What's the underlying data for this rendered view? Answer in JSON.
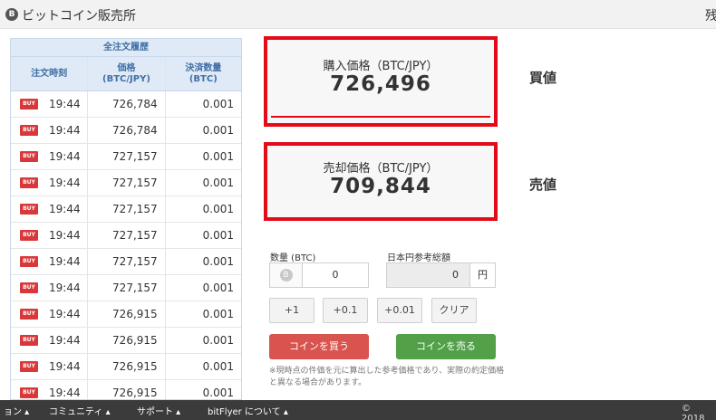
{
  "header": {
    "logo_glyph": "B",
    "title": "ビットコイン販売所",
    "right_cut_text": "残"
  },
  "history": {
    "title": "全注文履歴",
    "columns": [
      "注文時刻",
      "価格\n(BTC/JPY)",
      "決済数量\n(BTC)"
    ],
    "rows": [
      {
        "badge": "BUY",
        "time": "19:44",
        "price": "726,784",
        "qty": "0.001"
      },
      {
        "badge": "BUY",
        "time": "19:44",
        "price": "726,784",
        "qty": "0.001"
      },
      {
        "badge": "BUY",
        "time": "19:44",
        "price": "727,157",
        "qty": "0.001"
      },
      {
        "badge": "BUY",
        "time": "19:44",
        "price": "727,157",
        "qty": "0.001"
      },
      {
        "badge": "BUY",
        "time": "19:44",
        "price": "727,157",
        "qty": "0.001"
      },
      {
        "badge": "BUY",
        "time": "19:44",
        "price": "727,157",
        "qty": "0.001"
      },
      {
        "badge": "BUY",
        "time": "19:44",
        "price": "727,157",
        "qty": "0.001"
      },
      {
        "badge": "BUY",
        "time": "19:44",
        "price": "727,157",
        "qty": "0.001"
      },
      {
        "badge": "BUY",
        "time": "19:44",
        "price": "726,915",
        "qty": "0.001"
      },
      {
        "badge": "BUY",
        "time": "19:44",
        "price": "726,915",
        "qty": "0.001"
      },
      {
        "badge": "BUY",
        "time": "19:44",
        "price": "726,915",
        "qty": "0.001"
      },
      {
        "badge": "BUY",
        "time": "19:44",
        "price": "726,915",
        "qty": "0.001"
      }
    ]
  },
  "buy_price": {
    "label": "購入価格（BTC/JPY）",
    "value": "726,496",
    "side_label": "買値"
  },
  "sell_price": {
    "label": "売却価格（BTC/JPY）",
    "value": "709,844",
    "side_label": "売値"
  },
  "form": {
    "qty_label": "数量 (BTC)",
    "qty_value": "0",
    "jpy_label": "日本円参考総額",
    "jpy_value": "0",
    "jpy_unit": "円",
    "steps": [
      "+1",
      "+0.1",
      "+0.01",
      "クリア"
    ],
    "buy_button": "コインを買う",
    "sell_button": "コインを売る",
    "note": "※現時点の件価を元に算出した参考価格であり、実際の約定価格と異なる場合があります。"
  },
  "footer": {
    "items": [
      "ョン ▴",
      "コミュニティ ▴",
      "サポート ▴",
      "bitFlyer について ▴"
    ],
    "copyright": "© 2018"
  },
  "colors": {
    "highlight_border": "#e30b17",
    "buy_button": "#d9534f",
    "sell_button": "#52a149",
    "buy_badge": "#d9383a",
    "table_header": "#dfeaf6"
  }
}
